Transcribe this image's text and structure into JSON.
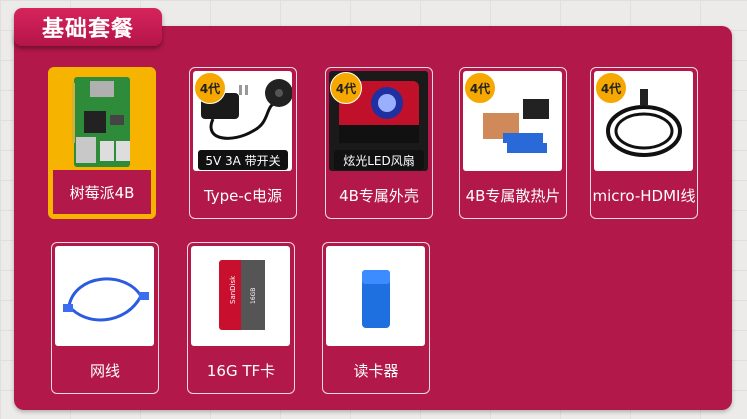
{
  "section_title": "基础套餐",
  "items_row1": [
    {
      "label": "树莓派4B",
      "badge": "",
      "caption": "",
      "icon": "raspberry-pi-board-icon"
    },
    {
      "label": "Type-c电源",
      "badge": "4代",
      "caption": "5V 3A 带开关",
      "icon": "power-adapter-icon"
    },
    {
      "label": "4B专属外壳",
      "badge": "4代",
      "caption": "炫光LED风扇",
      "icon": "case-fan-icon"
    },
    {
      "label": "4B专属散热片",
      "badge": "4代",
      "caption": "",
      "icon": "heatsink-icon"
    },
    {
      "label": "micro-HDMI线",
      "badge": "4代",
      "caption": "",
      "icon": "hdmi-cable-icon"
    }
  ],
  "items_row2": [
    {
      "label": "网线",
      "icon": "ethernet-cable-icon"
    },
    {
      "label": "16G TF卡",
      "icon": "sd-card-icon"
    },
    {
      "label": "读卡器",
      "icon": "card-reader-icon"
    }
  ],
  "sd_card_text": {
    "brand": "SanDisk",
    "sub": "Ultra",
    "size": "16GB"
  },
  "colors": {
    "panel": "#b3184a",
    "badge": "#f6a800",
    "selected": "#f6b400",
    "border": "#f3d9e2"
  }
}
